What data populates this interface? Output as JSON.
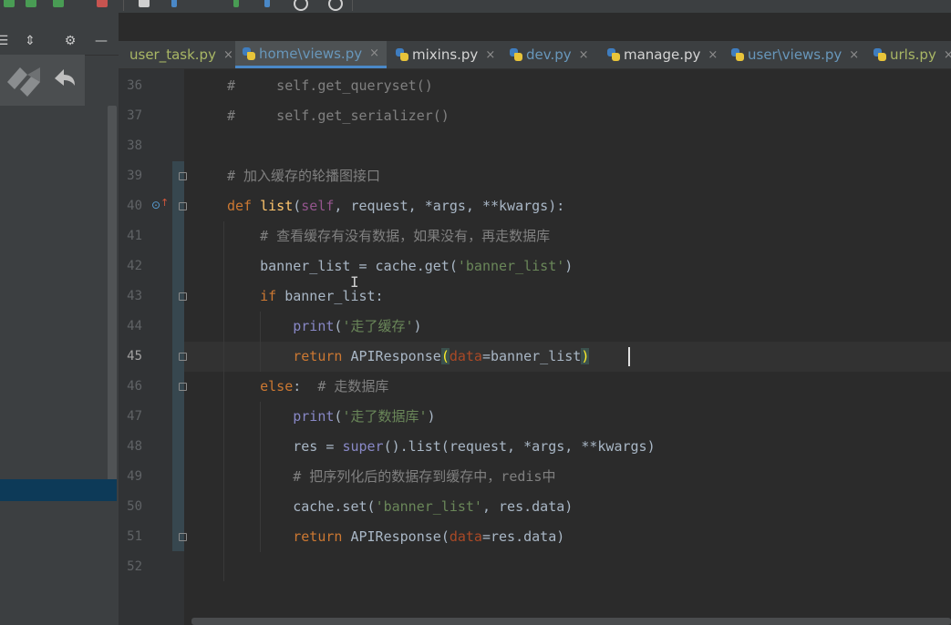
{
  "tabs": [
    {
      "label": "user_task.py",
      "color": "#a9b765"
    },
    {
      "label": "home\\views.py",
      "color": "#6897bb",
      "active": true
    },
    {
      "label": "mixins.py",
      "color": "#d4d4d4"
    },
    {
      "label": "dev.py",
      "color": "#6897bb"
    },
    {
      "label": "manage.py",
      "color": "#d4d4d4"
    },
    {
      "label": "user\\views.py",
      "color": "#6897bb"
    },
    {
      "label": "urls.py",
      "color": "#a9b765"
    }
  ],
  "tab_close_glyph": "×",
  "panel_header": {
    "icons": [
      "list-icon",
      "collapse-icon",
      "gear-icon",
      "minimize-icon"
    ]
  },
  "editor": {
    "current_line": "45",
    "lines": [
      {
        "num": "36",
        "segments": [
          {
            "t": "#     self.get_queryset()",
            "c": "t-cmt"
          }
        ]
      },
      {
        "num": "37",
        "segments": [
          {
            "t": "#     self.get_serializer()",
            "c": "t-cmt"
          }
        ]
      },
      {
        "num": "38",
        "segments": []
      },
      {
        "num": "39",
        "segments": [
          {
            "t": "# 加入缓存的轮播图接口",
            "c": "t-cmt"
          }
        ]
      },
      {
        "num": "40",
        "segments": [
          {
            "t": "def ",
            "c": "t-def"
          },
          {
            "t": "list",
            "c": "t-fn"
          },
          {
            "t": "(",
            "c": ""
          },
          {
            "t": "self",
            "c": "t-self"
          },
          {
            "t": ", request, *args, **kwargs):",
            "c": ""
          }
        ]
      },
      {
        "num": "41",
        "segments": [
          {
            "t": "    # 查看缓存有没有数据，如果没有，再走数据库",
            "c": "t-cmt"
          }
        ]
      },
      {
        "num": "42",
        "segments": [
          {
            "t": "    banner_list = cache.get(",
            "c": ""
          },
          {
            "t": "'banner_list'",
            "c": "t-str"
          },
          {
            "t": ")",
            "c": ""
          }
        ]
      },
      {
        "num": "43",
        "segments": [
          {
            "t": "    if ",
            "c": "t-kw"
          },
          {
            "t": "banner_list:",
            "c": ""
          }
        ]
      },
      {
        "num": "44",
        "segments": [
          {
            "t": "        print",
            "c": "t-builtin"
          },
          {
            "t": "(",
            "c": ""
          },
          {
            "t": "'走了缓存'",
            "c": "t-str"
          },
          {
            "t": ")",
            "c": ""
          }
        ]
      },
      {
        "num": "45",
        "segments": [
          {
            "t": "        return ",
            "c": "t-kw"
          },
          {
            "t": "APIResponse",
            "c": ""
          },
          {
            "t": "(",
            "c": "hl-paren"
          },
          {
            "t": "data",
            "c": "t-param"
          },
          {
            "t": "=banner_list",
            "c": ""
          },
          {
            "t": ")",
            "c": "hl-paren"
          }
        ]
      },
      {
        "num": "46",
        "segments": [
          {
            "t": "    else",
            "c": "t-kw"
          },
          {
            "t": ":  ",
            "c": ""
          },
          {
            "t": "# 走数据库",
            "c": "t-cmt"
          }
        ]
      },
      {
        "num": "47",
        "segments": [
          {
            "t": "        print",
            "c": "t-builtin"
          },
          {
            "t": "(",
            "c": ""
          },
          {
            "t": "'走了数据库'",
            "c": "t-str"
          },
          {
            "t": ")",
            "c": ""
          }
        ]
      },
      {
        "num": "48",
        "segments": [
          {
            "t": "        res = ",
            "c": ""
          },
          {
            "t": "super",
            "c": "t-builtin"
          },
          {
            "t": "().list(request, *args, **kwargs)",
            "c": ""
          }
        ]
      },
      {
        "num": "49",
        "segments": [
          {
            "t": "        # 把序列化后的数据存到缓存中，redis中",
            "c": "t-cmt"
          }
        ]
      },
      {
        "num": "50",
        "segments": [
          {
            "t": "        cache.set(",
            "c": ""
          },
          {
            "t": "'banner_list'",
            "c": "t-str"
          },
          {
            "t": ", res.data)",
            "c": ""
          }
        ]
      },
      {
        "num": "51",
        "segments": [
          {
            "t": "        return ",
            "c": "t-kw"
          },
          {
            "t": "APIResponse",
            "c": ""
          },
          {
            "t": "(",
            "c": ""
          },
          {
            "t": "data",
            "c": "t-param"
          },
          {
            "t": "=res.data)",
            "c": ""
          }
        ]
      },
      {
        "num": "52",
        "segments": []
      }
    ]
  }
}
